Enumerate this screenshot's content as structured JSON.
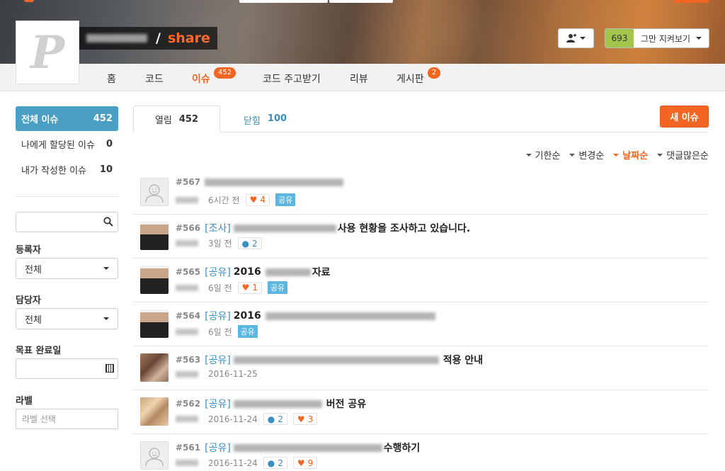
{
  "project": {
    "repo": "share",
    "slash": "/",
    "avatar_letter": "P"
  },
  "header": {
    "watch_count": "693",
    "watch_label": "그만 지켜보기"
  },
  "nav": [
    {
      "label": "홈"
    },
    {
      "label": "코드"
    },
    {
      "label": "이슈",
      "badge": "452"
    },
    {
      "label": "코드 주고받기"
    },
    {
      "label": "리뷰"
    },
    {
      "label": "게시판",
      "badge": "2"
    }
  ],
  "sidebar": {
    "filters": [
      {
        "label": "전체 이슈",
        "count": "452"
      },
      {
        "label": "나에게 할당된 이슈",
        "count": "0"
      },
      {
        "label": "내가 작성한 이슈",
        "count": "10"
      }
    ],
    "registrant_label": "등록자",
    "registrant_value": "전체",
    "assignee_label": "담당자",
    "assignee_value": "전체",
    "due_label": "목표 완료일",
    "labels_label": "라벨",
    "labels_placeholder": "라벨 선택"
  },
  "tabs": {
    "open_label": "열림",
    "open_count": "452",
    "closed_label": "닫힘",
    "closed_count": "100"
  },
  "new_issue_label": "새 이슈",
  "sorts": [
    "기한순",
    "변경순",
    "날짜순",
    "댓글많은순"
  ],
  "colors": {
    "accent": "#f26522",
    "link": "#3a8fc0",
    "active_filter": "#4a9fc4",
    "watch_green": "#a2c64c",
    "share_tag": "#5bb7e0"
  },
  "issues": [
    {
      "number": "#567",
      "category": "",
      "title_suffix": "",
      "meta": "6시간 전",
      "likes": "4",
      "comments": "",
      "tag": "공유",
      "avatar": "default-avatar"
    },
    {
      "number": "#566",
      "category": "[조사]",
      "title_suffix": "사용 현황을 조사하고 있습니다.",
      "meta": "3일 전",
      "likes": "",
      "comments": "2",
      "tag": "",
      "avatar": "person"
    },
    {
      "number": "#565",
      "category": "[공유]",
      "title_prefix": "2016",
      "title_suffix": "자료",
      "meta": "6일 전",
      "likes": "1",
      "comments": "",
      "tag": "공유",
      "avatar": "person"
    },
    {
      "number": "#564",
      "category": "[공유]",
      "title_prefix": "2016",
      "title_suffix": "",
      "meta": "6일 전",
      "likes": "",
      "comments": "",
      "tag": "공유",
      "avatar": "person"
    },
    {
      "number": "#563",
      "category": "[공유]",
      "title_suffix": "적용 안내",
      "meta": "2016-11-25",
      "likes": "",
      "comments": "",
      "tag": "",
      "avatar": "photo"
    },
    {
      "number": "#562",
      "category": "[공유]",
      "title_suffix": "버전 공유",
      "meta": "2016-11-24",
      "likes": "3",
      "comments": "2",
      "tag": "",
      "avatar": "photo"
    },
    {
      "number": "#561",
      "category": "[공유]",
      "title_suffix": "수행하기",
      "meta": "2016-11-24",
      "likes": "9",
      "comments": "2",
      "tag": "",
      "avatar": "default-avatar"
    }
  ]
}
